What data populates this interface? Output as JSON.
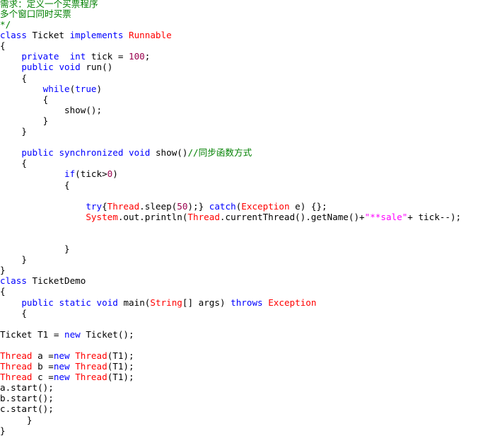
{
  "document": {
    "kind": "source-code-listing",
    "language": "Java",
    "background_color": "#ffffff",
    "font_kind": "monospace"
  },
  "theme": {
    "keyword_color": "#0000ff",
    "type_color": "#ff0000",
    "number_color": "#99004d",
    "string_color": "#ff00ff",
    "comment_color": "#008000",
    "plain_color": "#000000"
  },
  "lines": [
    {
      "id": 1,
      "tokens": [
        {
          "t": "需求：定义一个买票程序",
          "c": "comment"
        }
      ]
    },
    {
      "id": 2,
      "tokens": [
        {
          "t": "多个窗口同时买票",
          "c": "comment"
        }
      ]
    },
    {
      "id": 3,
      "tokens": [
        {
          "t": "*/",
          "c": "comment"
        }
      ]
    },
    {
      "id": 4,
      "tokens": [
        {
          "t": "class",
          "c": "kw"
        },
        {
          "t": " Ticket ",
          "c": "plain"
        },
        {
          "t": "implements",
          "c": "kw"
        },
        {
          "t": " ",
          "c": "plain"
        },
        {
          "t": "Runnable",
          "c": "type"
        }
      ]
    },
    {
      "id": 5,
      "tokens": [
        {
          "t": "{",
          "c": "plain"
        }
      ]
    },
    {
      "id": 6,
      "tokens": [
        {
          "t": "    ",
          "c": "plain"
        },
        {
          "t": "private",
          "c": "kw"
        },
        {
          "t": "  ",
          "c": "plain"
        },
        {
          "t": "int",
          "c": "kw"
        },
        {
          "t": " tick = ",
          "c": "plain"
        },
        {
          "t": "100",
          "c": "num"
        },
        {
          "t": ";",
          "c": "plain"
        }
      ]
    },
    {
      "id": 7,
      "tokens": [
        {
          "t": "    ",
          "c": "plain"
        },
        {
          "t": "public",
          "c": "kw"
        },
        {
          "t": " ",
          "c": "plain"
        },
        {
          "t": "void",
          "c": "kw"
        },
        {
          "t": " run()",
          "c": "plain"
        }
      ]
    },
    {
      "id": 8,
      "tokens": [
        {
          "t": "    {",
          "c": "plain"
        }
      ]
    },
    {
      "id": 9,
      "tokens": [
        {
          "t": "        ",
          "c": "plain"
        },
        {
          "t": "while",
          "c": "kw"
        },
        {
          "t": "(",
          "c": "plain"
        },
        {
          "t": "true",
          "c": "kw"
        },
        {
          "t": ")",
          "c": "plain"
        }
      ]
    },
    {
      "id": 10,
      "tokens": [
        {
          "t": "        {",
          "c": "plain"
        }
      ]
    },
    {
      "id": 11,
      "tokens": [
        {
          "t": "            show();",
          "c": "plain"
        }
      ]
    },
    {
      "id": 12,
      "tokens": [
        {
          "t": "        }",
          "c": "plain"
        }
      ]
    },
    {
      "id": 13,
      "tokens": [
        {
          "t": "    }",
          "c": "plain"
        }
      ]
    },
    {
      "id": 14,
      "tokens": [
        {
          "t": "",
          "c": "plain"
        }
      ]
    },
    {
      "id": 15,
      "tokens": [
        {
          "t": "    ",
          "c": "plain"
        },
        {
          "t": "public",
          "c": "kw"
        },
        {
          "t": " ",
          "c": "plain"
        },
        {
          "t": "synchronized",
          "c": "kw"
        },
        {
          "t": " ",
          "c": "plain"
        },
        {
          "t": "void",
          "c": "kw"
        },
        {
          "t": " show()",
          "c": "plain"
        },
        {
          "t": "//同步函数方式",
          "c": "comment"
        }
      ]
    },
    {
      "id": 16,
      "tokens": [
        {
          "t": "    {",
          "c": "plain"
        }
      ]
    },
    {
      "id": 17,
      "tokens": [
        {
          "t": "            ",
          "c": "plain"
        },
        {
          "t": "if",
          "c": "kw"
        },
        {
          "t": "(tick>",
          "c": "plain"
        },
        {
          "t": "0",
          "c": "num"
        },
        {
          "t": ")",
          "c": "plain"
        }
      ]
    },
    {
      "id": 18,
      "tokens": [
        {
          "t": "            {",
          "c": "plain"
        }
      ]
    },
    {
      "id": 19,
      "tokens": [
        {
          "t": "",
          "c": "plain"
        }
      ]
    },
    {
      "id": 20,
      "tokens": [
        {
          "t": "                ",
          "c": "plain"
        },
        {
          "t": "try",
          "c": "kw"
        },
        {
          "t": "{",
          "c": "plain"
        },
        {
          "t": "Thread",
          "c": "type"
        },
        {
          "t": ".sleep(",
          "c": "plain"
        },
        {
          "t": "50",
          "c": "num"
        },
        {
          "t": ");} ",
          "c": "plain"
        },
        {
          "t": "catch",
          "c": "kw"
        },
        {
          "t": "(",
          "c": "plain"
        },
        {
          "t": "Exception",
          "c": "type"
        },
        {
          "t": " e) {};",
          "c": "plain"
        }
      ]
    },
    {
      "id": 21,
      "tokens": [
        {
          "t": "                ",
          "c": "plain"
        },
        {
          "t": "System",
          "c": "type"
        },
        {
          "t": ".out.println(",
          "c": "plain"
        },
        {
          "t": "Thread",
          "c": "type"
        },
        {
          "t": ".currentThread().getName()+",
          "c": "plain"
        },
        {
          "t": "\"**sale\"",
          "c": "str"
        },
        {
          "t": "+ tick--);",
          "c": "plain"
        }
      ]
    },
    {
      "id": 22,
      "tokens": [
        {
          "t": "",
          "c": "plain"
        }
      ]
    },
    {
      "id": 23,
      "tokens": [
        {
          "t": "",
          "c": "plain"
        }
      ]
    },
    {
      "id": 24,
      "tokens": [
        {
          "t": "            }",
          "c": "plain"
        }
      ]
    },
    {
      "id": 25,
      "tokens": [
        {
          "t": "    }",
          "c": "plain"
        }
      ]
    },
    {
      "id": 26,
      "tokens": [
        {
          "t": "}",
          "c": "plain"
        }
      ]
    },
    {
      "id": 27,
      "tokens": [
        {
          "t": "class",
          "c": "kw"
        },
        {
          "t": " TicketDemo",
          "c": "plain"
        }
      ]
    },
    {
      "id": 28,
      "tokens": [
        {
          "t": "{",
          "c": "plain"
        }
      ]
    },
    {
      "id": 29,
      "tokens": [
        {
          "t": "    ",
          "c": "plain"
        },
        {
          "t": "public",
          "c": "kw"
        },
        {
          "t": " ",
          "c": "plain"
        },
        {
          "t": "static",
          "c": "kw"
        },
        {
          "t": " ",
          "c": "plain"
        },
        {
          "t": "void",
          "c": "kw"
        },
        {
          "t": " main(",
          "c": "plain"
        },
        {
          "t": "String",
          "c": "type"
        },
        {
          "t": "[] args) ",
          "c": "plain"
        },
        {
          "t": "throws",
          "c": "kw"
        },
        {
          "t": " ",
          "c": "plain"
        },
        {
          "t": "Exception",
          "c": "type"
        }
      ]
    },
    {
      "id": 30,
      "tokens": [
        {
          "t": "    {",
          "c": "plain"
        }
      ]
    },
    {
      "id": 31,
      "tokens": [
        {
          "t": "",
          "c": "plain"
        }
      ]
    },
    {
      "id": 32,
      "tokens": [
        {
          "t": "Ticket T1 = ",
          "c": "plain"
        },
        {
          "t": "new",
          "c": "kw"
        },
        {
          "t": " Ticket();",
          "c": "plain"
        }
      ]
    },
    {
      "id": 33,
      "tokens": [
        {
          "t": "",
          "c": "plain"
        }
      ]
    },
    {
      "id": 34,
      "tokens": [
        {
          "t": "Thread",
          "c": "type"
        },
        {
          "t": " a =",
          "c": "plain"
        },
        {
          "t": "new",
          "c": "kw"
        },
        {
          "t": " ",
          "c": "plain"
        },
        {
          "t": "Thread",
          "c": "type"
        },
        {
          "t": "(T1);",
          "c": "plain"
        }
      ]
    },
    {
      "id": 35,
      "tokens": [
        {
          "t": "Thread",
          "c": "type"
        },
        {
          "t": " b =",
          "c": "plain"
        },
        {
          "t": "new",
          "c": "kw"
        },
        {
          "t": " ",
          "c": "plain"
        },
        {
          "t": "Thread",
          "c": "type"
        },
        {
          "t": "(T1);",
          "c": "plain"
        }
      ]
    },
    {
      "id": 36,
      "tokens": [
        {
          "t": "Thread",
          "c": "type"
        },
        {
          "t": " c =",
          "c": "plain"
        },
        {
          "t": "new",
          "c": "kw"
        },
        {
          "t": " ",
          "c": "plain"
        },
        {
          "t": "Thread",
          "c": "type"
        },
        {
          "t": "(T1);",
          "c": "plain"
        }
      ]
    },
    {
      "id": 37,
      "tokens": [
        {
          "t": "a.start();",
          "c": "plain"
        }
      ]
    },
    {
      "id": 38,
      "tokens": [
        {
          "t": "b.start();",
          "c": "plain"
        }
      ]
    },
    {
      "id": 39,
      "tokens": [
        {
          "t": "c.start();",
          "c": "plain"
        }
      ]
    },
    {
      "id": 40,
      "tokens": [
        {
          "t": "     }",
          "c": "plain"
        }
      ]
    },
    {
      "id": 41,
      "tokens": [
        {
          "t": "}",
          "c": "plain"
        }
      ]
    }
  ]
}
